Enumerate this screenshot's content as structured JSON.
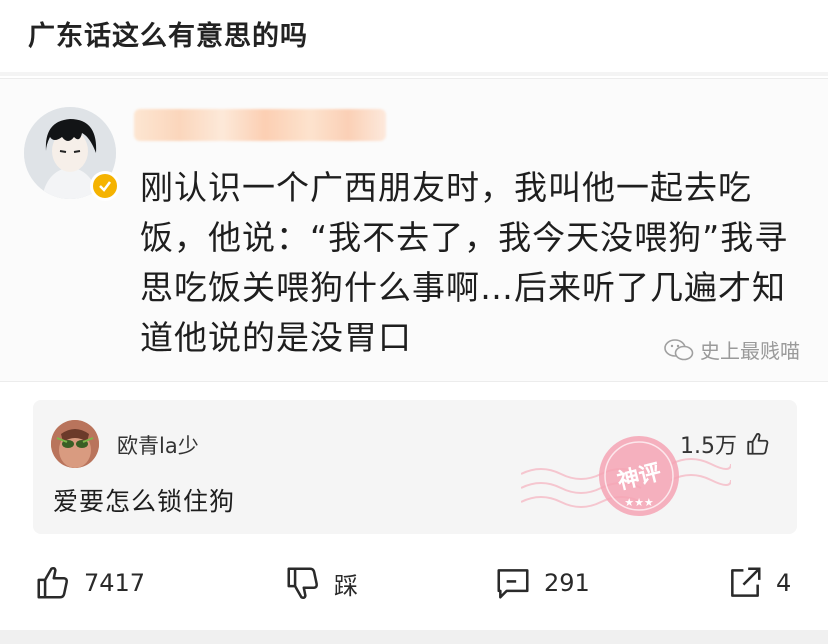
{
  "post": {
    "title": "广东话这么有意思的吗"
  },
  "screenshot": {
    "body_lines": [
      "刚认识一个广西朋友时，我叫他一起去吃",
      "饭，他说：“我不去了，我今天没喂狗”我寻",
      "思吃饭关喂狗什么事啊…后来听了几遍才知",
      "道他说的是没胃口"
    ],
    "watermark": "史上最贱喵",
    "badge_color": "#f5b301",
    "icons": {
      "badge": "verified-check-icon",
      "watermark": "wechat-icon"
    }
  },
  "comment": {
    "username": "欧青la少",
    "likes": "1.5万",
    "text": "爱要怎么锁住狗",
    "stamp_text": "神评",
    "stamp_color": "#f08aa0"
  },
  "actions": {
    "like_count": "7417",
    "dislike_label": "踩",
    "comment_count": "291",
    "share_count": "4",
    "icons": [
      "thumbs-up-icon",
      "thumbs-down-icon",
      "comment-icon",
      "share-icon"
    ]
  }
}
